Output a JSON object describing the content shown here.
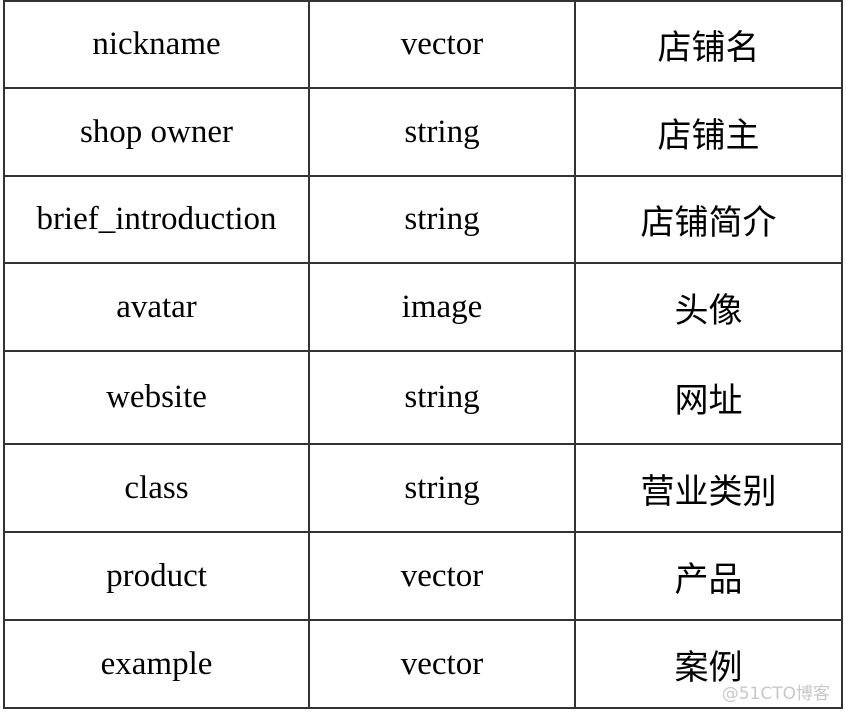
{
  "rows": [
    {
      "field": "nickname",
      "type": "vector",
      "desc": "店铺名"
    },
    {
      "field": "shop owner",
      "type": "string",
      "desc": "店铺主"
    },
    {
      "field": "brief_introduction",
      "type": "string",
      "desc": "店铺简介"
    },
    {
      "field": "avatar",
      "type": "image",
      "desc": "头像"
    },
    {
      "field": "website",
      "type": "string",
      "desc": "网址"
    },
    {
      "field": "class",
      "type": "string",
      "desc": "营业类别"
    },
    {
      "field": "product",
      "type": "vector",
      "desc": "产品"
    },
    {
      "field": "example",
      "type": "vector",
      "desc": "案例"
    }
  ],
  "watermark": "@51CTO博客"
}
